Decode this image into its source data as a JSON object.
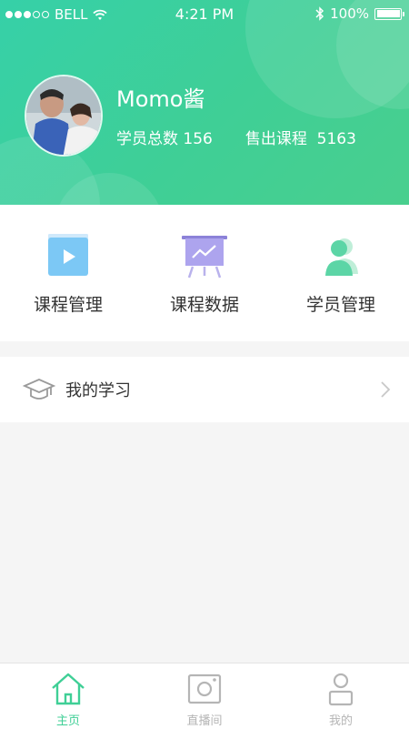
{
  "status_bar": {
    "carrier": "BELL",
    "time": "4:21 PM",
    "battery": "100%"
  },
  "profile": {
    "name": "Momo酱",
    "students_label": "学员总数",
    "students_count": "156",
    "sold_label": "售出课程",
    "sold_count": "5163"
  },
  "menu": [
    {
      "label": "课程管理",
      "icon": "video-play-icon"
    },
    {
      "label": "课程数据",
      "icon": "presentation-chart-icon"
    },
    {
      "label": "学员管理",
      "icon": "users-icon"
    }
  ],
  "my_study": {
    "label": "我的学习",
    "icon": "graduation-cap-icon"
  },
  "tabs": [
    {
      "label": "主页",
      "icon": "home-icon",
      "active": true
    },
    {
      "label": "直播间",
      "icon": "camera-icon",
      "active": false
    },
    {
      "label": "我的",
      "icon": "user-icon",
      "active": false
    }
  ],
  "colors": {
    "primary": "#3fcf96",
    "header_gradient_start": "#36d0a8",
    "header_gradient_end": "#49cf8e",
    "text_dark": "#333333",
    "tab_inactive": "#b5b5b5",
    "background": "#f5f5f5"
  }
}
